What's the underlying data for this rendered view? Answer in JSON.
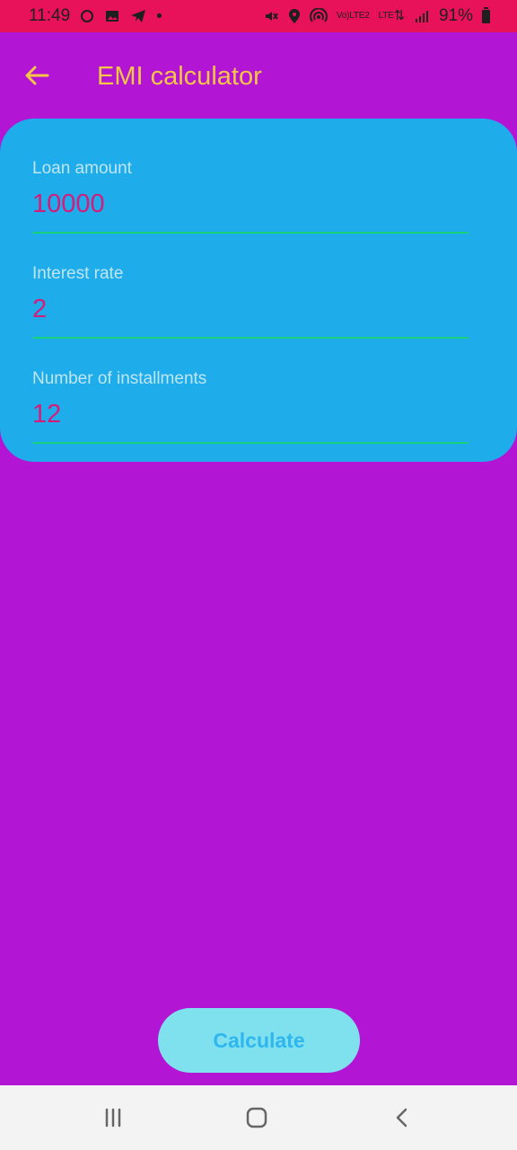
{
  "status_bar": {
    "time": "11:49",
    "battery": "91%",
    "network": "LTE",
    "network_sub": "LTE2",
    "volte": "Vo)",
    "icons": [
      "sync-icon",
      "image-icon",
      "telegram-icon",
      "dot-icon",
      "mute-icon",
      "location-icon",
      "hotspot-icon",
      "volte-icon",
      "lte-icon",
      "signal-icon",
      "battery-icon"
    ]
  },
  "app_bar": {
    "title": "EMI calculator",
    "back_icon": "arrow-left-icon"
  },
  "form": {
    "loan_amount": {
      "label": "Loan amount",
      "value": "10000"
    },
    "interest_rate": {
      "label": "Interest rate",
      "value": "2"
    },
    "installments": {
      "label": "Number of installments",
      "value": "12"
    }
  },
  "actions": {
    "calculate_label": "Calculate"
  },
  "navigation": {
    "icons": [
      "recent-apps-icon",
      "home-icon",
      "back-icon"
    ]
  },
  "colors": {
    "background": "#b215d3",
    "status_bar": "#e8125b",
    "title": "#f7c548",
    "card": "#1eaceb",
    "input_text": "#d41d7b",
    "input_line": "#17d17b",
    "button_bg": "#7fe1ee",
    "button_text": "#2fb6ee"
  }
}
